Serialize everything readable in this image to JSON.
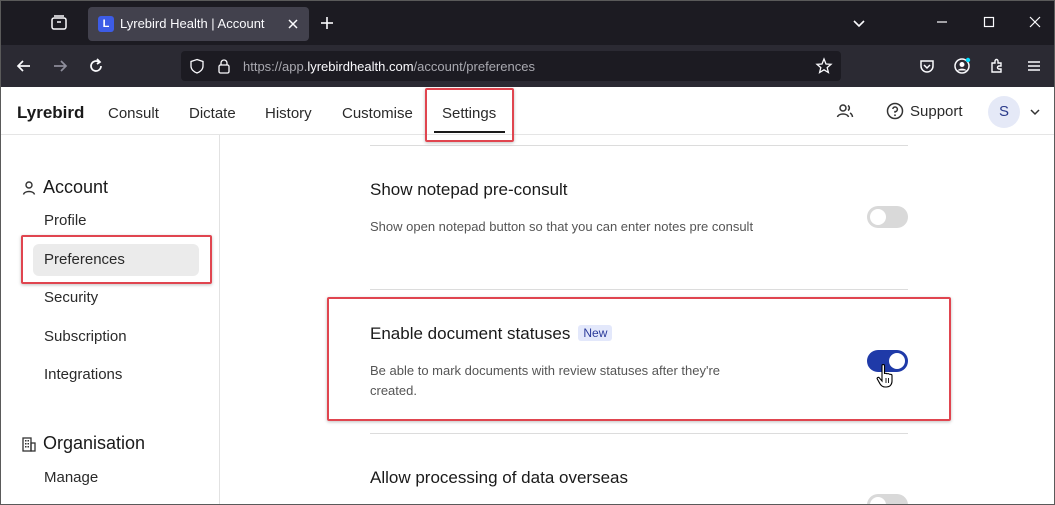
{
  "browser": {
    "tab_title": "Lyrebird Health | Account",
    "tab_favicon_letter": "L",
    "url_prefix": "https://app.",
    "url_host": "lyrebirdhealth.com",
    "url_path": "/account/preferences"
  },
  "app": {
    "brand": "Lyrebird",
    "nav": {
      "consult": "Consult",
      "dictate": "Dictate",
      "history": "History",
      "customise": "Customise",
      "settings": "Settings"
    },
    "support_label": "Support",
    "avatar_initial": "S"
  },
  "sidebar": {
    "account_heading": "Account",
    "account_items": {
      "profile": "Profile",
      "preferences": "Preferences",
      "security": "Security",
      "subscription": "Subscription",
      "integrations": "Integrations"
    },
    "organisation_heading": "Organisation",
    "organisation_items": {
      "manage": "Manage"
    }
  },
  "settings": [
    {
      "title": "Show notepad pre-consult",
      "description": "Show open notepad button so that you can enter notes pre consult",
      "enabled": false
    },
    {
      "title": "Enable document statuses",
      "badge": "New",
      "description": "Be able to mark documents with review statuses after they're created.",
      "enabled": true
    },
    {
      "title": "Allow processing of data overseas",
      "enabled": false
    }
  ],
  "colors": {
    "accent": "#1f3aa8",
    "highlight": "#e0454f"
  }
}
